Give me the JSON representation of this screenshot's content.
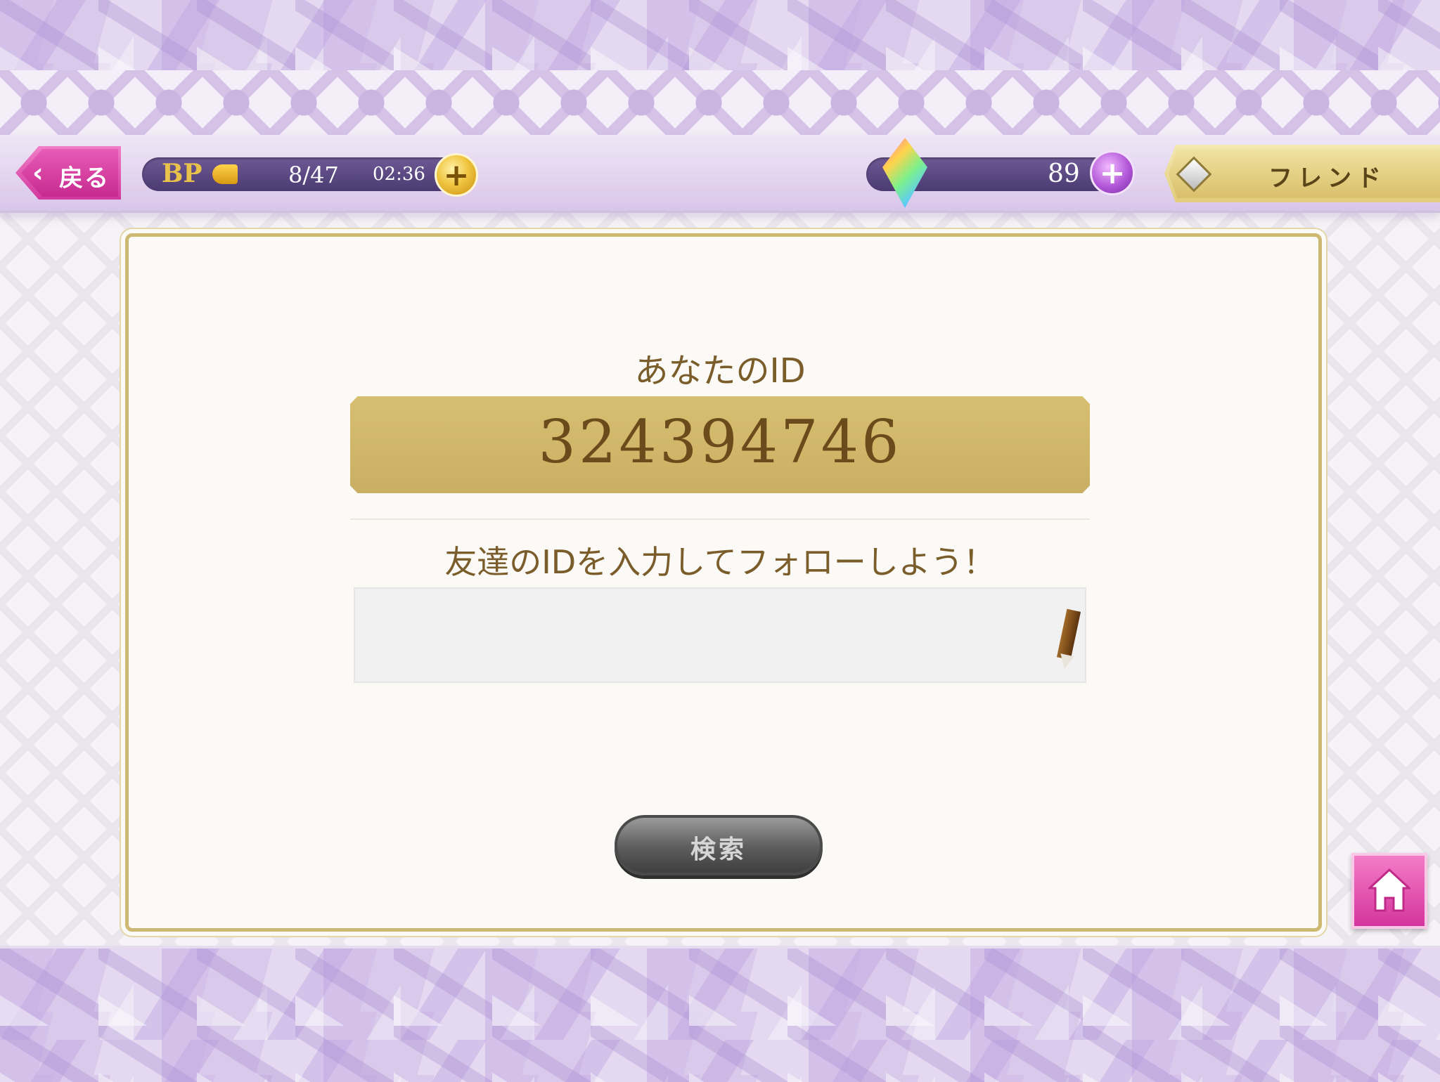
{
  "header": {
    "back_label": "戻る",
    "bp": {
      "label": "BP",
      "value": "8/47",
      "timer": "02:36",
      "fill_fraction": 0.17
    },
    "gems": {
      "value": "89"
    },
    "current_tab": "フレンド"
  },
  "main": {
    "id_title": "あなたのID",
    "id_value": "324394746",
    "prompt": "友達のIDを入力してフォローしよう！",
    "input_value": "",
    "search_label": "検索"
  },
  "colors": {
    "accent_pink": "#d5359d",
    "gold": "#cdb972",
    "purple_bar": "#4b3a72"
  },
  "icons": {
    "back": "chevron-left-icon",
    "bp_plus": "plus-icon",
    "gem": "gem-icon",
    "gem_plus": "plus-icon",
    "friend": "diamond-icon",
    "edit": "pencil-icon",
    "home": "home-icon"
  }
}
